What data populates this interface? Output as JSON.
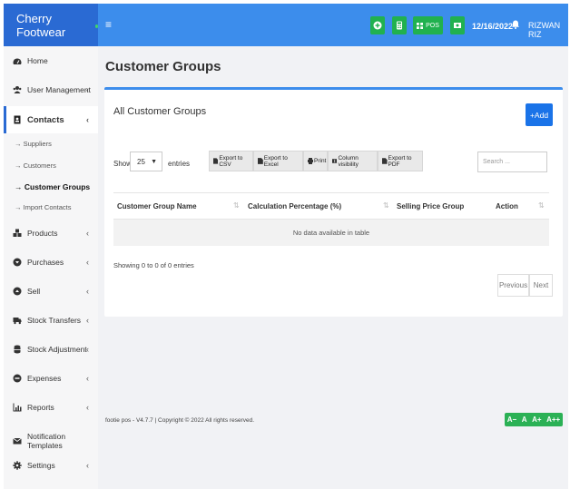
{
  "brand": {
    "name": "Cherry Footwear"
  },
  "topbar": {
    "menu_icon": "≡",
    "pos_label": "POS",
    "date": "12/16/2022",
    "user": "RIZWAN RIZ"
  },
  "sidebar": {
    "items": [
      {
        "label": "Home",
        "icon": "dashboard-icon",
        "chevron": ""
      },
      {
        "label": "User Management",
        "icon": "users-icon",
        "chevron": "‹"
      },
      {
        "label": "Contacts",
        "icon": "address-book-icon",
        "chevron": "‹"
      },
      {
        "label": "Products",
        "icon": "cubes-icon",
        "chevron": "‹"
      },
      {
        "label": "Purchases",
        "icon": "arrow-circle-down-icon",
        "chevron": "‹"
      },
      {
        "label": "Sell",
        "icon": "arrow-circle-up-icon",
        "chevron": "‹"
      },
      {
        "label": "Stock Transfers",
        "icon": "truck-icon",
        "chevron": "‹"
      },
      {
        "label": "Stock Adjustment",
        "icon": "database-icon",
        "chevron": "‹"
      },
      {
        "label": "Expenses",
        "icon": "minus-circle-icon",
        "chevron": "‹"
      },
      {
        "label": "Reports",
        "icon": "chart-icon",
        "chevron": "‹"
      },
      {
        "label": "Notification Templates",
        "icon": "envelope-icon",
        "chevron": ""
      },
      {
        "label": "Settings",
        "icon": "cog-icon",
        "chevron": "‹"
      }
    ],
    "contacts_sub": [
      {
        "label": "→ Suppliers"
      },
      {
        "label": "→ Customers"
      },
      {
        "label": "→ Customer Groups"
      },
      {
        "label": "→ Import Contacts"
      }
    ]
  },
  "page": {
    "title": "Customer Groups",
    "card_title": "All Customer Groups",
    "add_label": "+Add",
    "show_label": "Show",
    "page_size": "25",
    "entries_label": "entries",
    "export_buttons": [
      "Export to CSV",
      "Export to Excel",
      "Print",
      "Column visibility",
      "Export to PDF"
    ],
    "search_placeholder": "Search ...",
    "columns": [
      "Customer Group Name",
      "Calculation Percentage (%)",
      "Selling Price Group",
      "Action"
    ],
    "empty_message": "No data available in table",
    "info": "Showing 0 to 0 of 0 entries",
    "prev_label": "Previous",
    "next_label": "Next"
  },
  "footer": {
    "text": "footie pos - V4.7.7 | Copyright © 2022 All rights reserved.",
    "font_sizes": [
      "A−",
      "A",
      "A+",
      "A++"
    ]
  },
  "colors": {
    "brand": "#2a6ad3",
    "topbar": "#3c8dec",
    "success": "#21b14f",
    "primary": "#1a73e8"
  }
}
